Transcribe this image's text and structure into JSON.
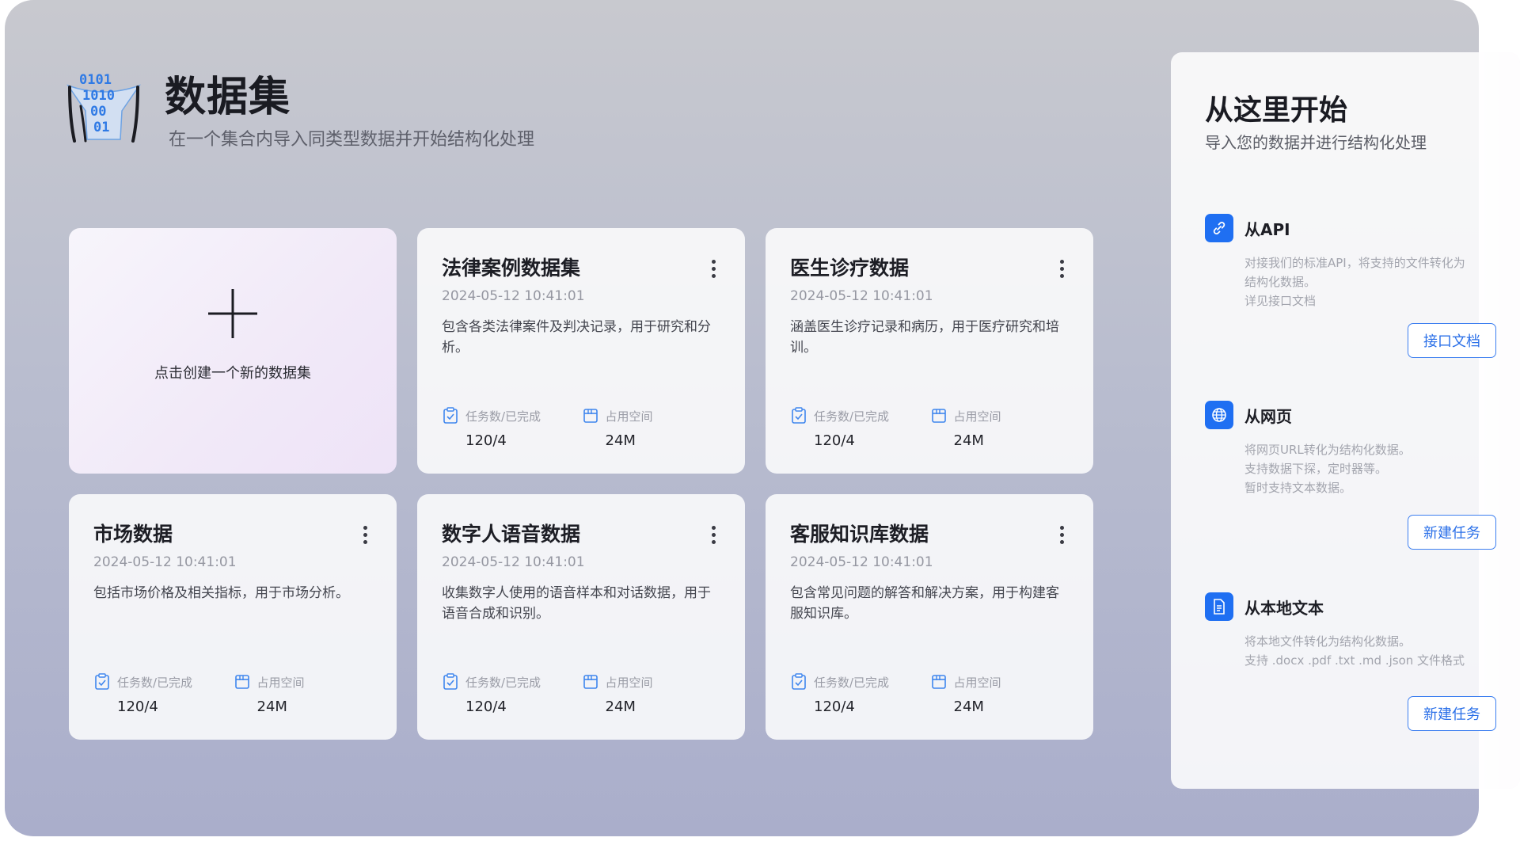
{
  "header": {
    "title": "数据集",
    "subtitle": "在一个集合内导入同类型数据并开始结构化处理",
    "logo_icon": "binary-funnel-icon"
  },
  "create_card": {
    "label": "点击创建一个新的数据集",
    "icon": "plus-icon"
  },
  "datasets": [
    {
      "title": "法律案例数据集",
      "date": "2024-05-12 10:41:01",
      "description": "包含各类法律案件及判决记录，用于研究和分析。",
      "tasks_label": "任务数/已完成",
      "tasks_value": "120/4",
      "space_label": "占用空间",
      "space_value": "24M"
    },
    {
      "title": "医生诊疗数据",
      "date": "2024-05-12 10:41:01",
      "description": "涵盖医生诊疗记录和病历，用于医疗研究和培训。",
      "tasks_label": "任务数/已完成",
      "tasks_value": "120/4",
      "space_label": "占用空间",
      "space_value": "24M"
    },
    {
      "title": "市场数据",
      "date": "2024-05-12 10:41:01",
      "description": "包括市场价格及相关指标，用于市场分析。",
      "tasks_label": "任务数/已完成",
      "tasks_value": "120/4",
      "space_label": "占用空间",
      "space_value": "24M"
    },
    {
      "title": "数字人语音数据",
      "date": "2024-05-12 10:41:01",
      "description": "收集数字人使用的语音样本和对话数据，用于语音合成和识别。",
      "tasks_label": "任务数/已完成",
      "tasks_value": "120/4",
      "space_label": "占用空间",
      "space_value": "24M"
    },
    {
      "title": "客服知识库数据",
      "date": "2024-05-12 10:41:01",
      "description": "包含常见问题的解答和解决方案，用于构建客服知识库。",
      "tasks_label": "任务数/已完成",
      "tasks_value": "120/4",
      "space_label": "占用空间",
      "space_value": "24M"
    }
  ],
  "side_panel": {
    "title": "从这里开始",
    "subtitle": "导入您的数据并进行结构化处理",
    "sources": [
      {
        "name": "从API",
        "icon": "link-icon",
        "lines": [
          "对接我们的标准API，将支持的文件转化为",
          "结构化数据。",
          "详见接口文档"
        ],
        "button": "接口文档"
      },
      {
        "name": "从网页",
        "icon": "globe-icon",
        "lines": [
          "将网页URL转化为结构化数据。",
          "支持数据下探，定时器等。",
          "暂时支持文本数据。"
        ],
        "button": "新建任务"
      },
      {
        "name": "从本地文本",
        "icon": "document-icon",
        "lines": [
          "将本地文件转化为结构化数据。",
          "支持 .docx .pdf .txt .md .json 文件格式"
        ],
        "button": "新建任务"
      }
    ]
  },
  "colors": {
    "accent": "#1f6ff2",
    "background_top": "#c8c9cf",
    "background_bottom": "#aaaecb",
    "card": "#ffffff"
  }
}
